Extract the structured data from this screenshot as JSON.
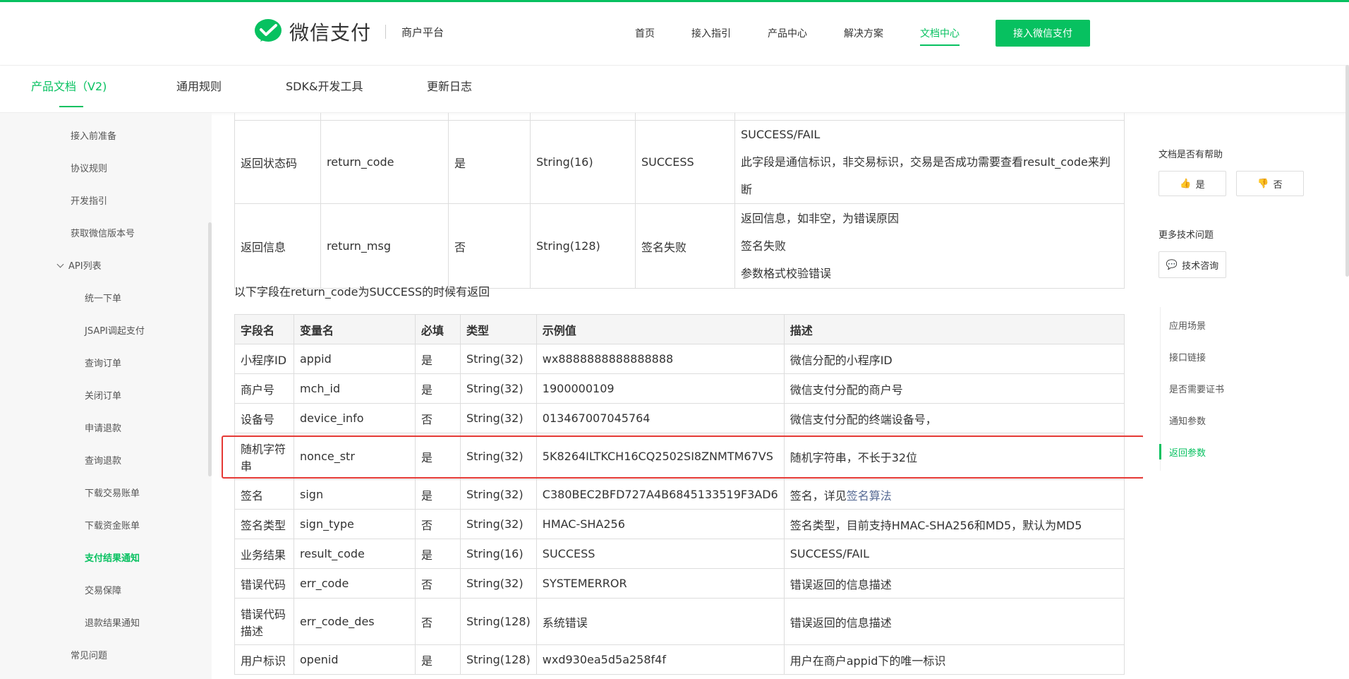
{
  "header": {
    "brand_name": "微信支付",
    "brand_sub": "商户平台",
    "nav": [
      {
        "label": "首页",
        "active": false
      },
      {
        "label": "接入指引",
        "active": false
      },
      {
        "label": "产品中心",
        "active": false
      },
      {
        "label": "解决方案",
        "active": false
      },
      {
        "label": "文档中心",
        "active": true
      }
    ],
    "cta_label": "接入微信支付",
    "accent_color": "#07c160"
  },
  "subnav": {
    "items": [
      {
        "label": "产品文档（V2)",
        "active": true
      },
      {
        "label": "通用规则",
        "active": false
      },
      {
        "label": "SDK&开发工具",
        "active": false
      },
      {
        "label": "更新日志",
        "active": false
      }
    ]
  },
  "sidebar": {
    "items": [
      {
        "label": "接入前准备",
        "level": 1
      },
      {
        "label": "协议规则",
        "level": 1
      },
      {
        "label": "开发指引",
        "level": 1
      },
      {
        "label": "获取微信版本号",
        "level": 1
      },
      {
        "label": "API列表",
        "level": 1,
        "expanded": true
      },
      {
        "label": "统一下单",
        "level": 2
      },
      {
        "label": "JSAPI调起支付",
        "level": 2
      },
      {
        "label": "查询订单",
        "level": 2
      },
      {
        "label": "关闭订单",
        "level": 2
      },
      {
        "label": "申请退款",
        "level": 2
      },
      {
        "label": "查询退款",
        "level": 2
      },
      {
        "label": "下载交易账单",
        "level": 2
      },
      {
        "label": "下载资金账单",
        "level": 2
      },
      {
        "label": "支付结果通知",
        "level": 2,
        "active": true
      },
      {
        "label": "交易保障",
        "level": 2
      },
      {
        "label": "退款结果通知",
        "level": 2
      },
      {
        "label": "常见问题",
        "level": 1
      }
    ]
  },
  "main": {
    "table1": {
      "rows": [
        {
          "name": "返回状态码",
          "var": "return_code",
          "required": "是",
          "type": "String(16)",
          "example": "SUCCESS",
          "desc": [
            "SUCCESS/FAIL",
            "此字段是通信标识，非交易标识，交易是否成功需要查看result_code来判断"
          ]
        },
        {
          "name": "返回信息",
          "var": "return_msg",
          "required": "否",
          "type": "String(128)",
          "example": "签名失败",
          "desc": [
            "返回信息，如非空，为错误原因",
            "签名失败",
            "参数格式校验错误"
          ]
        }
      ]
    },
    "note": "以下字段在return_code为SUCCESS的时候有返回",
    "table2": {
      "headers": [
        "字段名",
        "变量名",
        "必填",
        "类型",
        "示例值",
        "描述"
      ],
      "rows": [
        {
          "name": "小程序ID",
          "var": "appid",
          "required": "是",
          "type": "String(32)",
          "example": "wx8888888888888888",
          "desc": "微信分配的小程序ID"
        },
        {
          "name": "商户号",
          "var": "mch_id",
          "required": "是",
          "type": "String(32)",
          "example": "1900000109",
          "desc": "微信支付分配的商户号"
        },
        {
          "name": "设备号",
          "var": "device_info",
          "required": "否",
          "type": "String(32)",
          "example": "013467007045764",
          "desc": "微信支付分配的终端设备号，"
        },
        {
          "name": "随机字符串",
          "var": "nonce_str",
          "required": "是",
          "type": "String(32)",
          "example": "5K8264ILTKCH16CQ2502SI8ZNMTM67VS",
          "desc": "随机字符串，不长于32位"
        },
        {
          "name": "签名",
          "var": "sign",
          "required": "是",
          "type": "String(32)",
          "example": "C380BEC2BFD727A4B6845133519F3AD6",
          "desc": "签名，详见",
          "desc_link": "签名算法"
        },
        {
          "name": "签名类型",
          "var": "sign_type",
          "required": "否",
          "type": "String(32)",
          "example": "HMAC-SHA256",
          "desc": "签名类型，目前支持HMAC-SHA256和MD5，默认为MD5"
        },
        {
          "name": "业务结果",
          "var": "result_code",
          "required": "是",
          "type": "String(16)",
          "example": "SUCCESS",
          "desc": "SUCCESS/FAIL"
        },
        {
          "name": "错误代码",
          "var": "err_code",
          "required": "否",
          "type": "String(32)",
          "example": "SYSTEMERROR",
          "desc": "错误返回的信息描述"
        },
        {
          "name": "错误代码描述",
          "var": "err_code_des",
          "required": "否",
          "type": "String(128)",
          "example": "系统错误",
          "desc": "错误返回的信息描述"
        },
        {
          "name": "用户标识",
          "var": "openid",
          "required": "是",
          "type": "String(128)",
          "example": "wxd930ea5d5a258f4f",
          "desc": "用户在商户appid下的唯一标识"
        }
      ]
    },
    "highlight_color": "#e53935"
  },
  "right": {
    "help_title": "文档是否有帮助",
    "yes_label": "是",
    "no_label": "否",
    "more_title": "更多技术问题",
    "consult_label": "技术咨询",
    "toc": [
      {
        "label": "应用场景",
        "active": false
      },
      {
        "label": "接口链接",
        "active": false
      },
      {
        "label": "是否需要证书",
        "active": false
      },
      {
        "label": "通知参数",
        "active": false
      },
      {
        "label": "返回参数",
        "active": true
      }
    ]
  }
}
